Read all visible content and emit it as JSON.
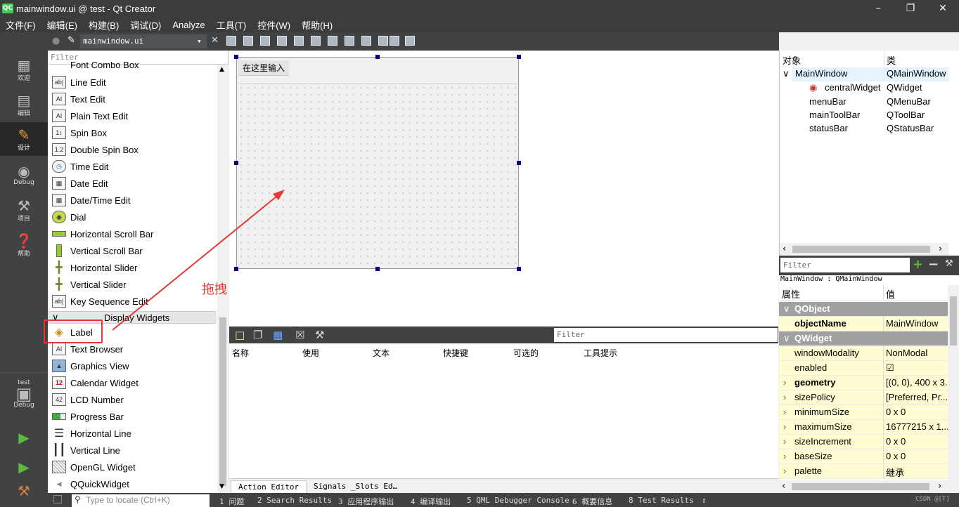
{
  "window": {
    "title": "mainwindow.ui @ test - Qt Creator",
    "logo": "QC"
  },
  "menu": [
    "文件(F)",
    "编辑(E)",
    "构建(B)",
    "调试(D)",
    "Analyze",
    "工具(T)",
    "控件(W)",
    "帮助(H)"
  ],
  "modes": [
    {
      "label": "欢迎",
      "icon": "grid-icon"
    },
    {
      "label": "编辑",
      "icon": "document-icon"
    },
    {
      "label": "设计",
      "icon": "pencil-icon"
    },
    {
      "label": "Debug",
      "icon": "bug-icon"
    },
    {
      "label": "项目",
      "icon": "wrench-icon"
    },
    {
      "label": "帮助",
      "icon": "help-icon"
    }
  ],
  "kit": {
    "project": "test",
    "config": "Debug"
  },
  "editor": {
    "file": "mainwindow.ui"
  },
  "widgetbox": {
    "filter_placeholder": "Filter",
    "items": [
      "Font Combo Box",
      "Line Edit",
      "Text Edit",
      "Plain Text Edit",
      "Spin Box",
      "Double Spin Box",
      "Time Edit",
      "Date Edit",
      "Date/Time Edit",
      "Dial",
      "Horizontal Scroll Bar",
      "Vertical Scroll Bar",
      "Horizontal Slider",
      "Vertical Slider",
      "Key Sequence Edit"
    ],
    "category": "Display Widgets",
    "display_items": [
      "Label",
      "Text Browser",
      "Graphics View",
      "Calendar Widget",
      "LCD Number",
      "Progress Bar",
      "Horizontal Line",
      "Vertical Line",
      "OpenGL Widget",
      "QQuickWidget"
    ]
  },
  "form": {
    "menu_placeholder": "在这里输入"
  },
  "annotation": {
    "drag_label": "拖拽",
    "color": "#e53935"
  },
  "action_editor": {
    "filter_placeholder": "Filter",
    "columns": [
      "名称",
      "使用",
      "文本",
      "快捷键",
      "可选的",
      "工具提示"
    ],
    "tabs": [
      "Action Editor",
      "Signals _Slots Ed…"
    ]
  },
  "object_inspector": {
    "headers": [
      "对象",
      "类"
    ],
    "rows": [
      {
        "name": "MainWindow",
        "class": "QMainWindow"
      },
      {
        "name": "centralWidget",
        "class": "QWidget"
      },
      {
        "name": "menuBar",
        "class": "QMenuBar"
      },
      {
        "name": "mainToolBar",
        "class": "QToolBar"
      },
      {
        "name": "statusBar",
        "class": "QStatusBar"
      }
    ]
  },
  "property_editor": {
    "filter_placeholder": "Filter",
    "class_line": "MainWindow : QMainWindow",
    "headers": [
      "属性",
      "值"
    ],
    "rows": [
      {
        "group": "QObject"
      },
      {
        "name": "objectName",
        "value": "MainWindow"
      },
      {
        "group": "QWidget"
      },
      {
        "name": "windowModality",
        "value": "NonModal"
      },
      {
        "name": "enabled",
        "value": "☑"
      },
      {
        "name": "geometry",
        "value": "[(0, 0), 400 x 3..."
      },
      {
        "name": "sizePolicy",
        "value": "[Preferred, Pr..."
      },
      {
        "name": "minimumSize",
        "value": "0 x 0"
      },
      {
        "name": "maximumSize",
        "value": "16777215 x 1..."
      },
      {
        "name": "sizeIncrement",
        "value": "0 x 0"
      },
      {
        "name": "baseSize",
        "value": "0 x 0"
      },
      {
        "name": "palette",
        "value": "继承"
      }
    ]
  },
  "statusbar": {
    "locate_placeholder": "Type to locate (Ctrl+K)",
    "panes": [
      "1 问题",
      "2 Search Results",
      "3 应用程序输出",
      "4 编译输出",
      "5 QML Debugger Console",
      "6 概要信息",
      "8 Test Results"
    ],
    "watermark": "CSDN @[T]"
  }
}
